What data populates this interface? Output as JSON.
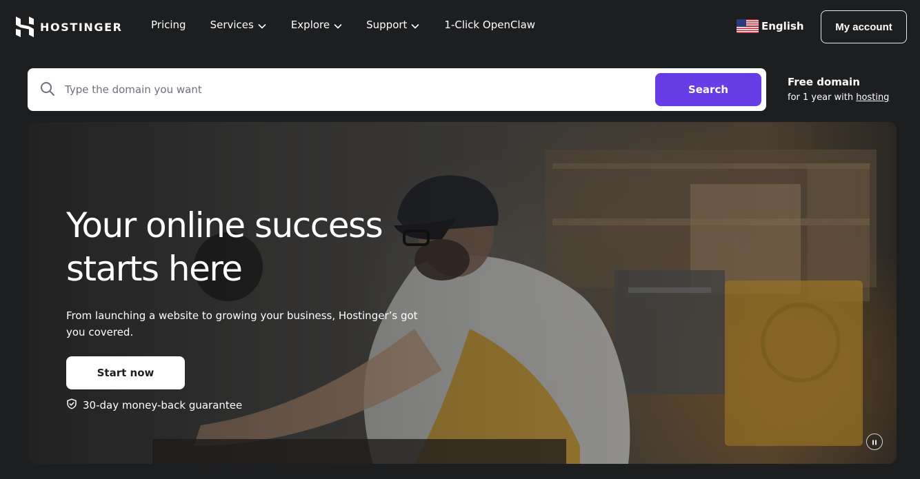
{
  "brand": {
    "name": "HOSTINGER"
  },
  "nav": {
    "items": [
      {
        "label": "Pricing",
        "has_dropdown": false
      },
      {
        "label": "Services",
        "has_dropdown": true
      },
      {
        "label": "Explore",
        "has_dropdown": true
      },
      {
        "label": "Support",
        "has_dropdown": true
      },
      {
        "label": "1-Click OpenClaw",
        "has_dropdown": false
      }
    ]
  },
  "language": {
    "label": "English",
    "flag_icon": "us-flag-icon"
  },
  "account": {
    "label": "My account"
  },
  "search": {
    "placeholder": "Type the domain you want",
    "value": "",
    "button_label": "Search"
  },
  "promo": {
    "title": "Free domain",
    "subtitle_prefix": "for 1 year with ",
    "subtitle_link": "hosting"
  },
  "hero": {
    "title_line1": "Your online success",
    "title_line2": "starts here",
    "subtitle": "From launching a website to growing your business, Hostinger’s got you covered.",
    "cta_label": "Start now",
    "guarantee": "30-day money-back guarantee"
  },
  "colors": {
    "background": "#1d1e20",
    "accent": "#673de6",
    "text": "#ffffff"
  },
  "icons": [
    "hostinger-logo-icon",
    "chevron-down-icon",
    "us-flag-icon",
    "search-icon",
    "shield-check-icon",
    "pause-icon"
  ]
}
